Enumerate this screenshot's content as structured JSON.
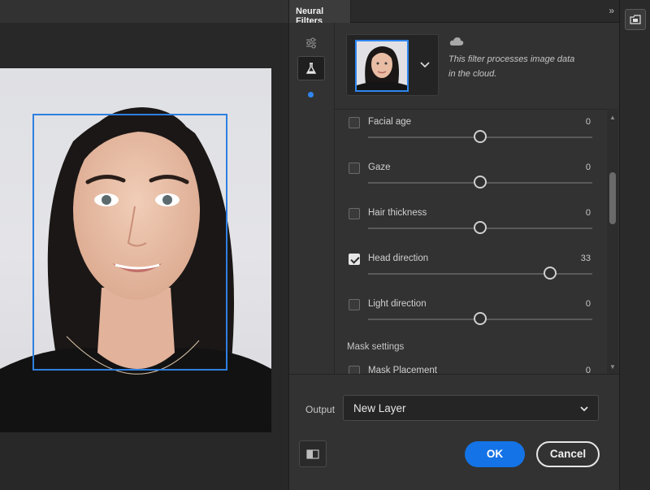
{
  "panel": {
    "title": "Neural Filters",
    "cloud_text_line1": "This filter processes image data",
    "cloud_text_line2": "in the cloud."
  },
  "filters": [
    {
      "label": "Facial age",
      "value": "0",
      "checked": false,
      "level": 0
    },
    {
      "label": "Gaze",
      "value": "0",
      "checked": false,
      "level": 0
    },
    {
      "label": "Hair thickness",
      "value": "0",
      "checked": false,
      "level": 0
    },
    {
      "label": "Head direction",
      "value": "33",
      "checked": true,
      "level": 33
    },
    {
      "label": "Light direction",
      "value": "0",
      "checked": false,
      "level": 0
    }
  ],
  "mask": {
    "section_label": "Mask settings",
    "placement_label": "Mask Placement",
    "placement_value": "0"
  },
  "output": {
    "label": "Output",
    "selected": "New Layer"
  },
  "buttons": {
    "ok": "OK",
    "cancel": "Cancel"
  },
  "icons": {
    "collapse": "double-chevron-right-icon",
    "sliders": "sliders-icon",
    "flask": "flask-icon",
    "cloud": "cloud-icon",
    "compare": "compare-icon",
    "panel_toggle": "panel-icon"
  },
  "colors": {
    "accent": "#1473e6",
    "face_box": "#2f7fe0"
  }
}
